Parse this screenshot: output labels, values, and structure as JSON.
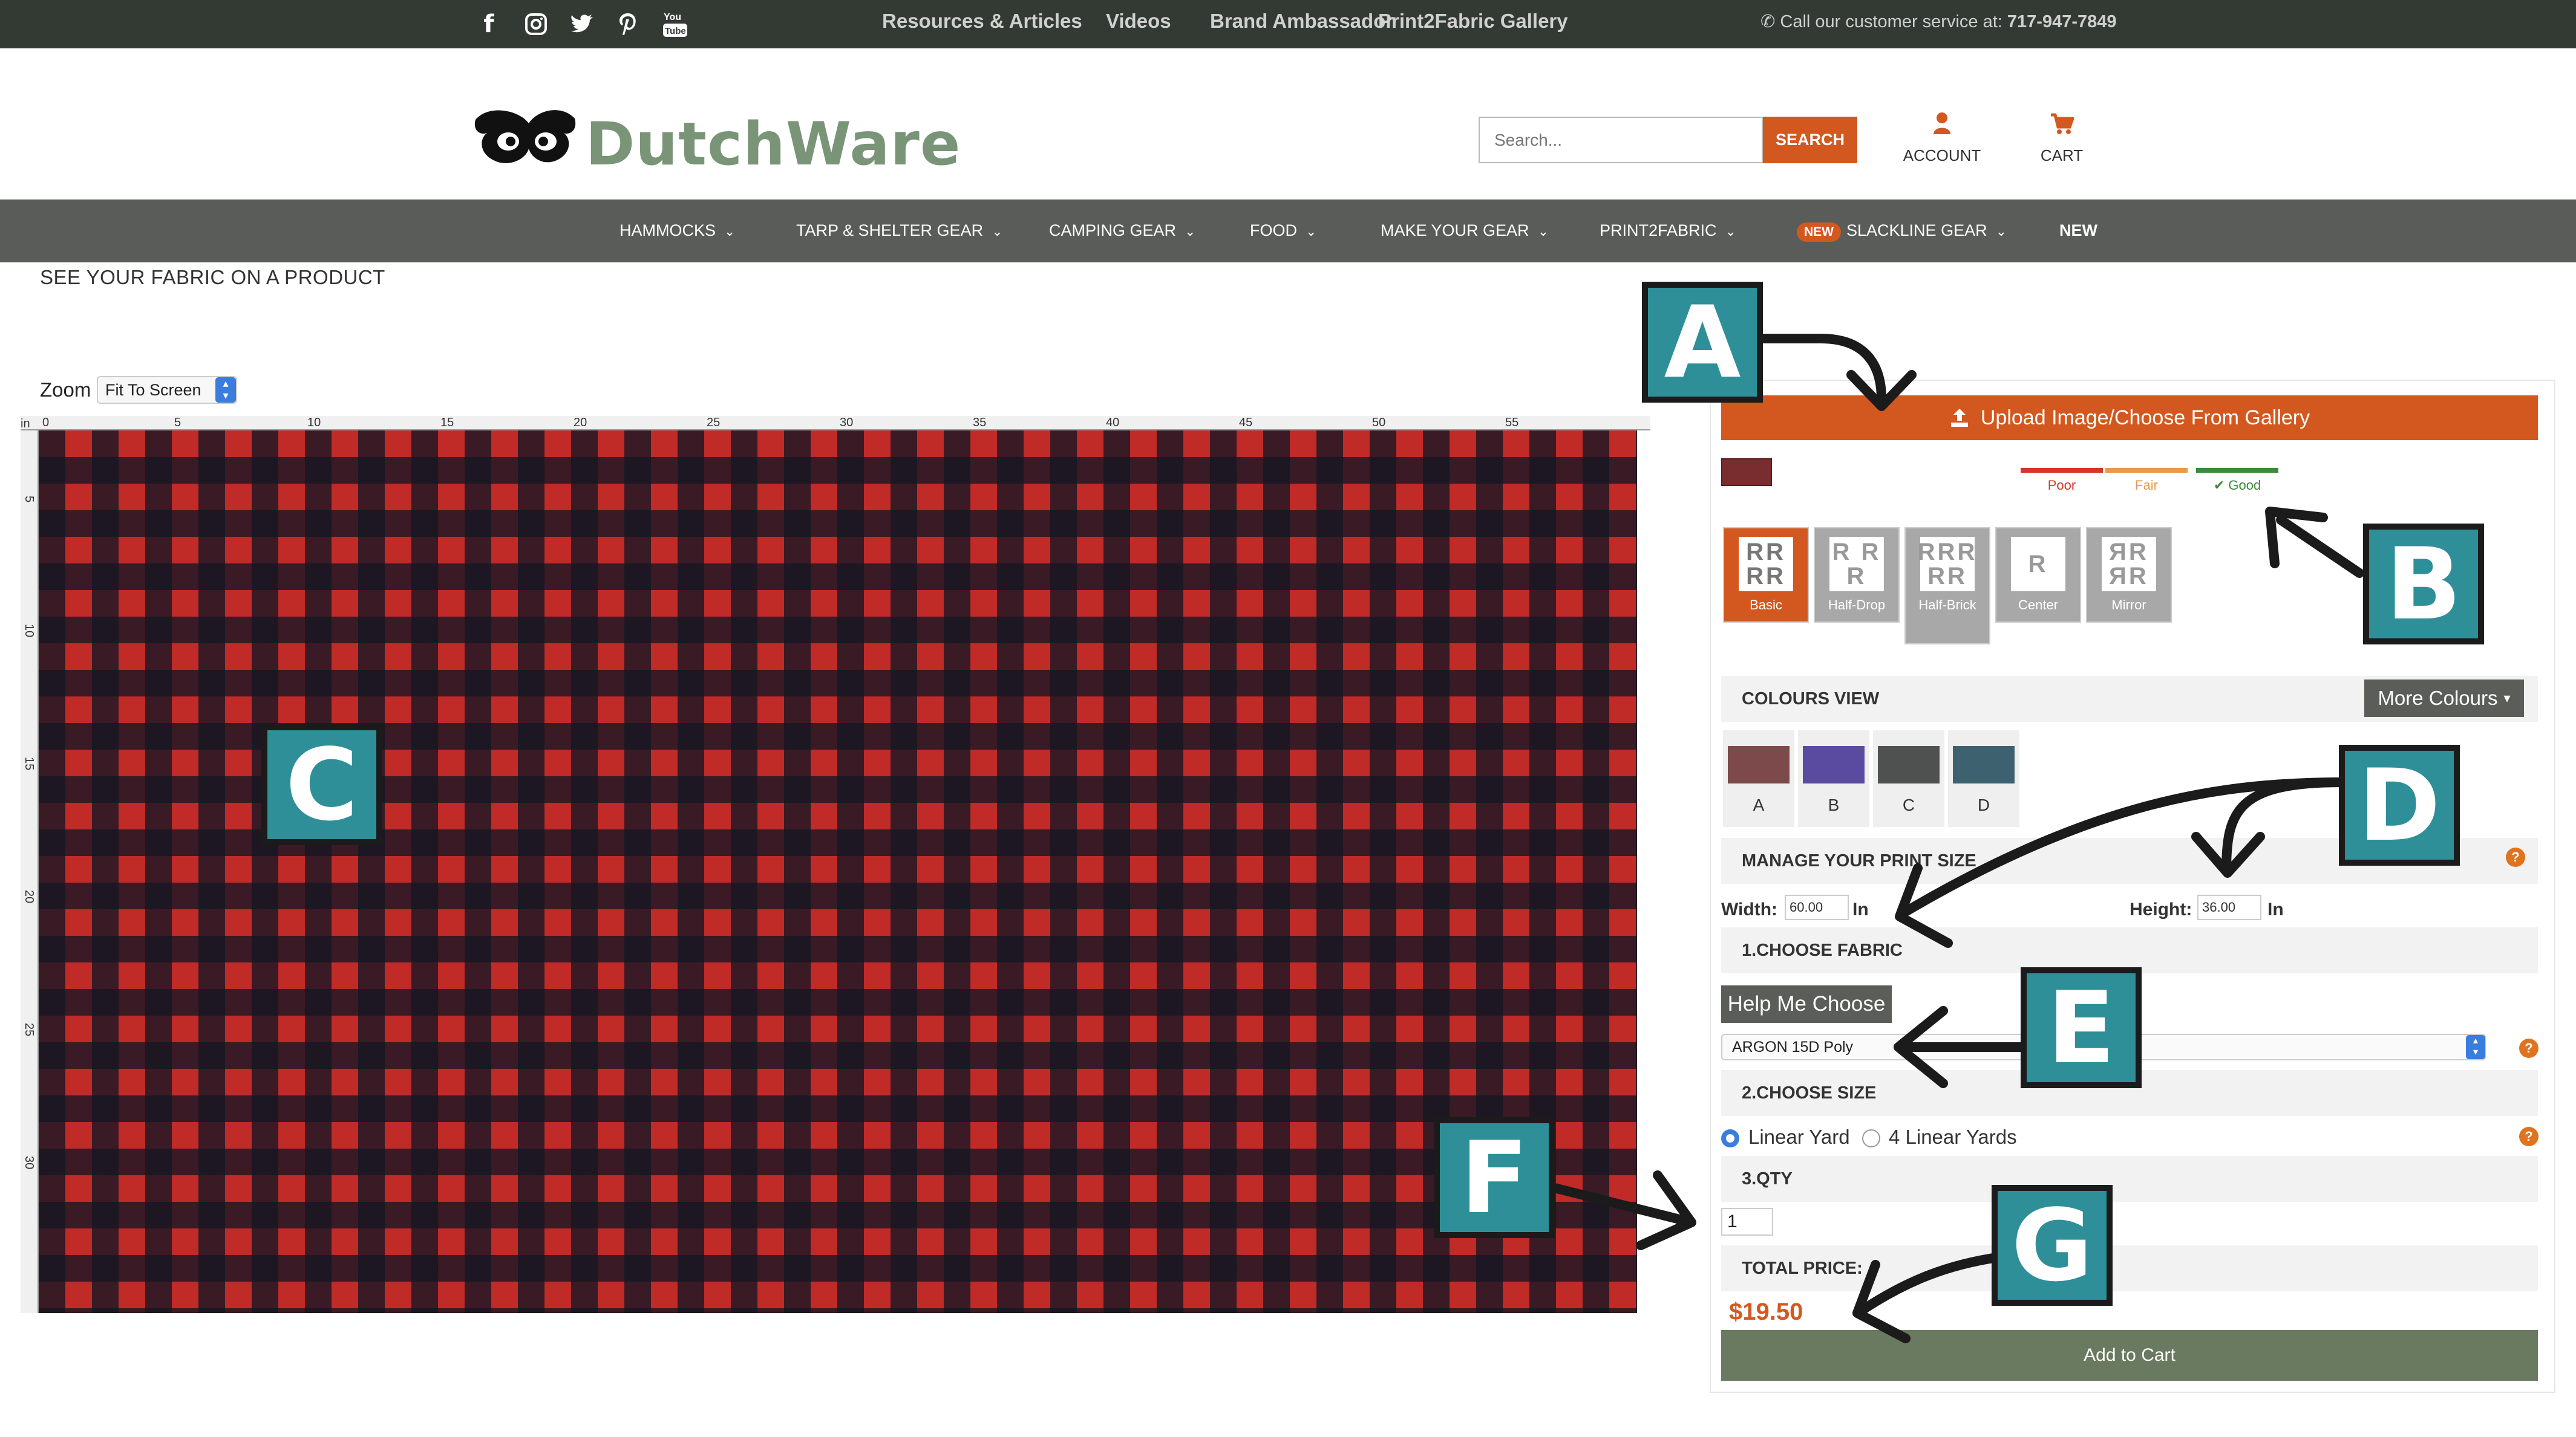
{
  "topbar": {
    "links": [
      "Resources & Articles",
      "Videos",
      "Brand Ambassador",
      "Print2Fabric Gallery"
    ],
    "phone_label": "Call our customer service at:",
    "phone_number": "717-947-7849"
  },
  "header": {
    "logo_text": "DutchWare",
    "logo_tm": "™",
    "search_placeholder": "Search...",
    "search_button": "SEARCH",
    "account_label": "ACCOUNT",
    "cart_label": "CART"
  },
  "nav": {
    "items": [
      "HAMMOCKS",
      "TARP & SHELTER GEAR",
      "CAMPING GEAR",
      "FOOD",
      "MAKE YOUR GEAR",
      "PRINT2FABRIC",
      "SLACKLINE GEAR",
      "NEW"
    ],
    "new_badge": "NEW"
  },
  "page": {
    "title": "SEE YOUR FABRIC ON A PRODUCT",
    "zoom_label": "Zoom",
    "zoom_value": "Fit To Screen",
    "ruler_unit": "in",
    "ruler_top": [
      "0",
      "5",
      "10",
      "15",
      "20",
      "25",
      "30",
      "35",
      "40",
      "45",
      "50",
      "55"
    ],
    "ruler_left": [
      "5",
      "10",
      "15",
      "20",
      "25",
      "30"
    ]
  },
  "panel": {
    "upload_label": "Upload Image/Choose From Gallery",
    "quality": [
      "Poor",
      "Fair",
      "Good"
    ],
    "layouts": [
      {
        "label": "Basic",
        "glyph": "RR RR"
      },
      {
        "label": "Half-Drop",
        "glyph": "R R R"
      },
      {
        "label": "Half-Brick",
        "glyph": "RRR RR"
      },
      {
        "label": "Center",
        "glyph": "R"
      },
      {
        "label": "Mirror",
        "glyph": "ЯR ЯR"
      }
    ],
    "colours_view": "COLOURS VIEW",
    "more_colours": "More Colours",
    "colour_options": [
      {
        "label": "A",
        "color": "#7d4a4c"
      },
      {
        "label": "B",
        "color": "#5a4aa0"
      },
      {
        "label": "C",
        "color": "#4e5150"
      },
      {
        "label": "D",
        "color": "#3e6170"
      }
    ],
    "manage_print": "MANAGE YOUR PRINT SIZE",
    "width_label": "Width:",
    "width_value": "60.00",
    "height_label": "Height:",
    "height_value": "36.00",
    "unit": "In",
    "choose_fabric": "1.CHOOSE FABRIC",
    "help_choose": "Help Me Choose",
    "fabric_value": "ARGON 15D Poly",
    "choose_size": "2.CHOOSE SIZE",
    "size_options": [
      "Linear Yard",
      "4 Linear Yards"
    ],
    "qty_title": "3.QTY",
    "qty_value": "1",
    "total_title": "TOTAL PRICE:",
    "total_value": "$19.50",
    "add_to_cart": "Add to Cart"
  },
  "callouts": [
    "A",
    "B",
    "C",
    "D",
    "E",
    "F",
    "G"
  ],
  "colors": {
    "accent": "#d2581f",
    "callout": "#2e8f99",
    "topbar": "#333a33",
    "navbar": "#595c58",
    "cart_button": "#6a7a60"
  }
}
